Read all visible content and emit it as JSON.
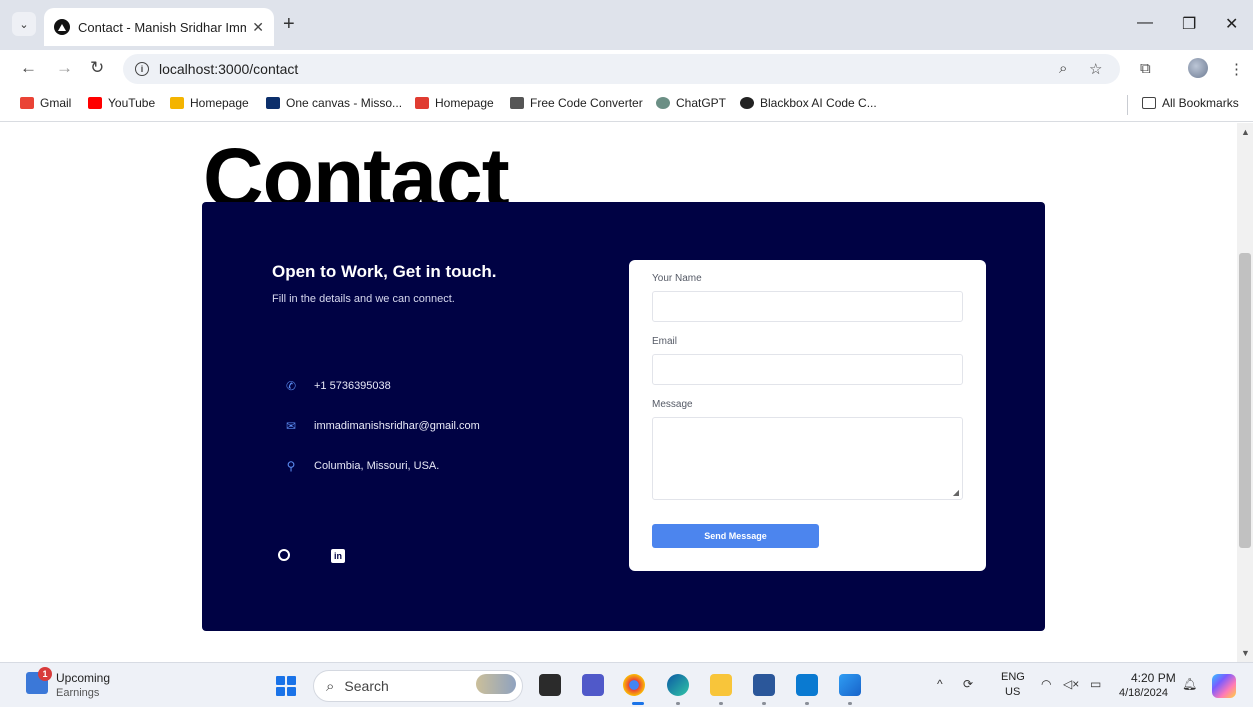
{
  "browser": {
    "tab_title": "Contact - Manish Sridhar Imm…",
    "url": "localhost:3000/contact",
    "bookmarks": [
      {
        "label": "Gmail",
        "color": "#ea4335"
      },
      {
        "label": "YouTube",
        "color": "#ff0000"
      },
      {
        "label": "Homepage",
        "color": "#f4b400"
      },
      {
        "label": "One canvas - Misso...",
        "color": "#0c2f6b"
      },
      {
        "label": "Homepage",
        "color": "#e03c31"
      },
      {
        "label": "Free Code Converter",
        "color": "#555555"
      },
      {
        "label": "ChatGPT",
        "color": "#6b8f85"
      },
      {
        "label": "Blackbox AI Code C...",
        "color": "#222222"
      }
    ],
    "all_bookmarks": "All Bookmarks"
  },
  "page": {
    "heading": "Contact",
    "card": {
      "title": "Open to Work, Get in touch.",
      "subtitle": "Fill in the details and we can connect.",
      "phone": "+1 5736395038",
      "email": "immadimanishsridhar@gmail.com",
      "location": "Columbia, Missouri, USA.",
      "bg_color": "#000244"
    },
    "form": {
      "name_label": "Your Name",
      "email_label": "Email",
      "message_label": "Message",
      "submit_label": "Send Message",
      "button_color": "#4c85ee"
    }
  },
  "taskbar": {
    "weather_line1": "Upcoming",
    "weather_line2": "Earnings",
    "notification_count": "1",
    "search_placeholder": "Search",
    "lang_line1": "ENG",
    "lang_line2": "US",
    "time": "4:20 PM",
    "date": "4/18/2024"
  }
}
